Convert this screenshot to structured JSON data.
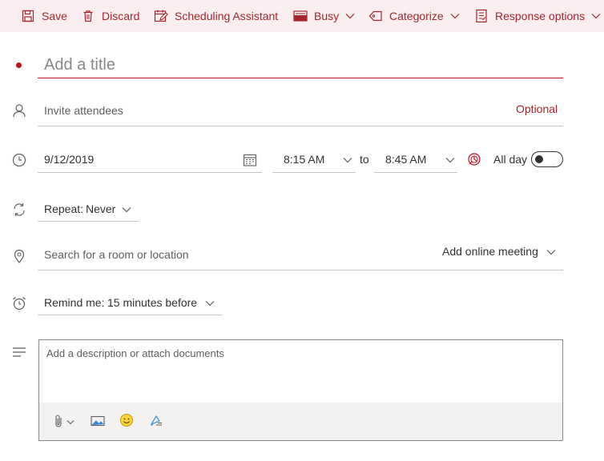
{
  "toolbar": {
    "save_label": "Save",
    "discard_label": "Discard",
    "scheduling_label": "Scheduling Assistant",
    "busy_label": "Busy",
    "categorize_label": "Categorize",
    "response_label": "Response options"
  },
  "title": {
    "placeholder": "Add a title"
  },
  "attendees": {
    "placeholder": "Invite attendees",
    "optional_label": "Optional"
  },
  "datetime": {
    "date": "9/12/2019",
    "start_time": "8:15 AM",
    "to_label": "to",
    "end_time": "8:45 AM",
    "all_day_label": "All day",
    "all_day_on": false
  },
  "repeat": {
    "label": "Repeat:",
    "value": "Never"
  },
  "location": {
    "placeholder": "Search for a room or location",
    "online_meeting_label": "Add online meeting"
  },
  "reminder": {
    "label": "Remind me:",
    "value": "15 minutes before"
  },
  "description": {
    "placeholder": "Add a description or attach documents"
  },
  "colors": {
    "accent": "#a4262c",
    "required_dot": "#c50f1f",
    "toolbar_bg": "#fbeef0",
    "footer_bg": "#f3f2f1"
  }
}
